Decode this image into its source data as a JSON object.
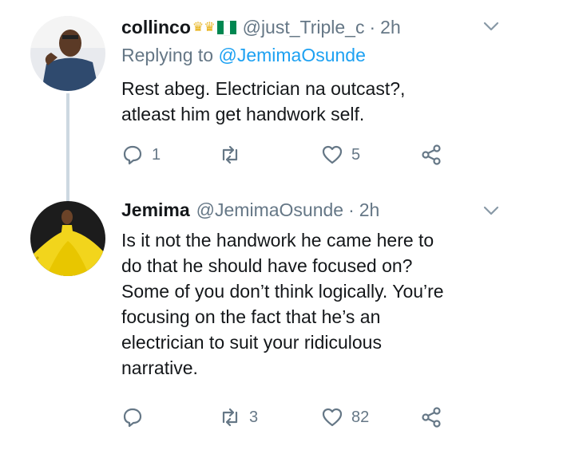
{
  "tweets": [
    {
      "name": "collinco",
      "handle": "@just_Triple_c",
      "separator": "·",
      "time": "2h",
      "replying_to_prefix": "Replying to",
      "replying_to_handle": "@JemimaOsunde",
      "text_lines": [
        "Rest abeg. Electrician na outcast?,",
        "atleast him get handwork self."
      ],
      "replies": "1",
      "retweets": "",
      "likes": "5"
    },
    {
      "name": "Jemima",
      "handle": "@JemimaOsunde",
      "separator": "·",
      "time": "2h",
      "text_lines": [
        "Is it not the handwork he came here to",
        "do that he should have focused on?",
        "Some of you don’t think logically. You’re",
        "focusing on the fact that he’s an",
        "electrician to suit your ridiculous",
        "narrative."
      ],
      "replies": "",
      "retweets": "3",
      "likes": "82"
    }
  ],
  "icons": {
    "reply": "reply-icon",
    "retweet": "retweet-icon",
    "like": "like-icon",
    "share": "share-icon",
    "more": "chevron-down-icon"
  },
  "colors": {
    "name": "#14171a",
    "secondary": "#657786",
    "link": "#1da1f2",
    "thread_line": "#cdd8e1",
    "flag_green": "#008751"
  }
}
